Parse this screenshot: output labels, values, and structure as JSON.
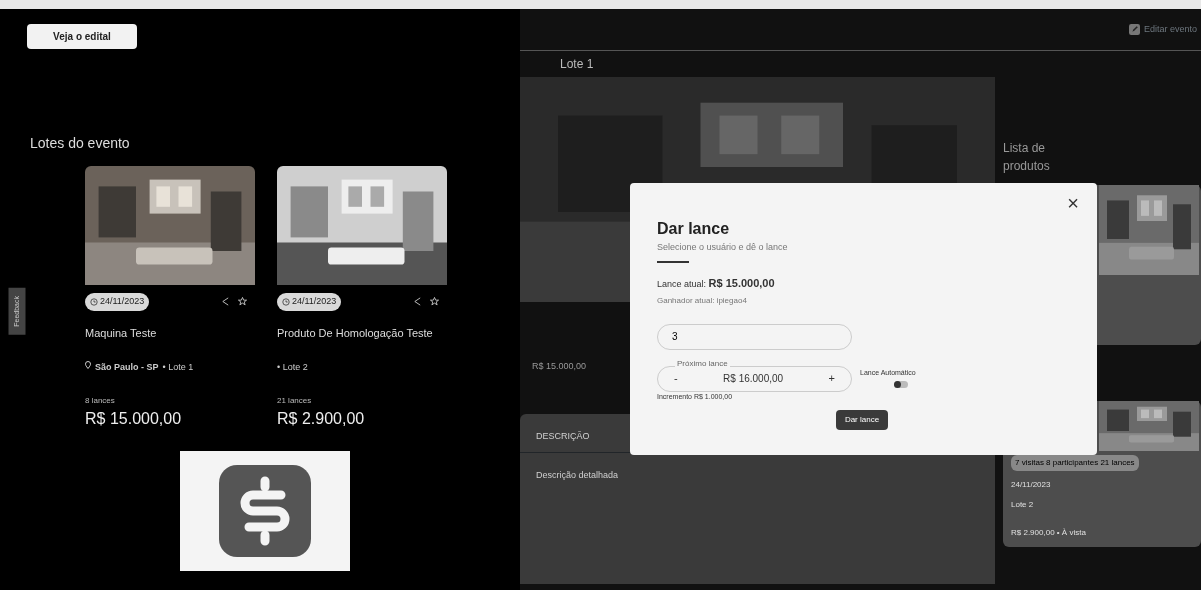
{
  "left": {
    "edital_button": "Veja o edital",
    "feedback_tab": "Feedback",
    "section_title": "Lotes do evento",
    "lots": [
      {
        "date": "24/11/2023",
        "title": "Maquina Teste",
        "location": "São Paulo - SP",
        "lot": "• Lote 1",
        "bids": "8 lances",
        "price": "R$ 15.000,00",
        "favorite": false
      },
      {
        "date": "24/11/2023",
        "title": "Produto De Homologação Teste",
        "lot": "• Lote 2",
        "bids": "21 lances",
        "price": "R$ 2.900,00",
        "favorite": false
      }
    ]
  },
  "detail": {
    "edit_button": "Editar evento",
    "title": "Lote 1",
    "tab": "DESCRIÇÃO",
    "description": "Descrição detalhada",
    "value": "R$ 15.000,00"
  },
  "products": {
    "title": "Lista de produtos",
    "items": [
      {
        "stats": "7 visitas 8 participantes 21 lances",
        "date": "24/11/2023",
        "title": "Lote 2",
        "price": "R$ 2.900,00 • À vista"
      }
    ]
  },
  "modal": {
    "title": "Dar lance",
    "subtitle": "Selecione o usuário e dê o lance",
    "current_label": "Lance atual:",
    "current_value": "R$ 15.000,00",
    "winner": "Ganhador atual: ipiegao4",
    "bidder_value": "3",
    "next_label": "Próximo lance",
    "next_value": "R$ 16.000,00",
    "minus": "-",
    "plus": "+",
    "auto": {
      "label": "Lance Automático",
      "on": false
    },
    "increment": "Incremento R$ 1.000,00",
    "submit": "Dar lance",
    "close": "×"
  }
}
